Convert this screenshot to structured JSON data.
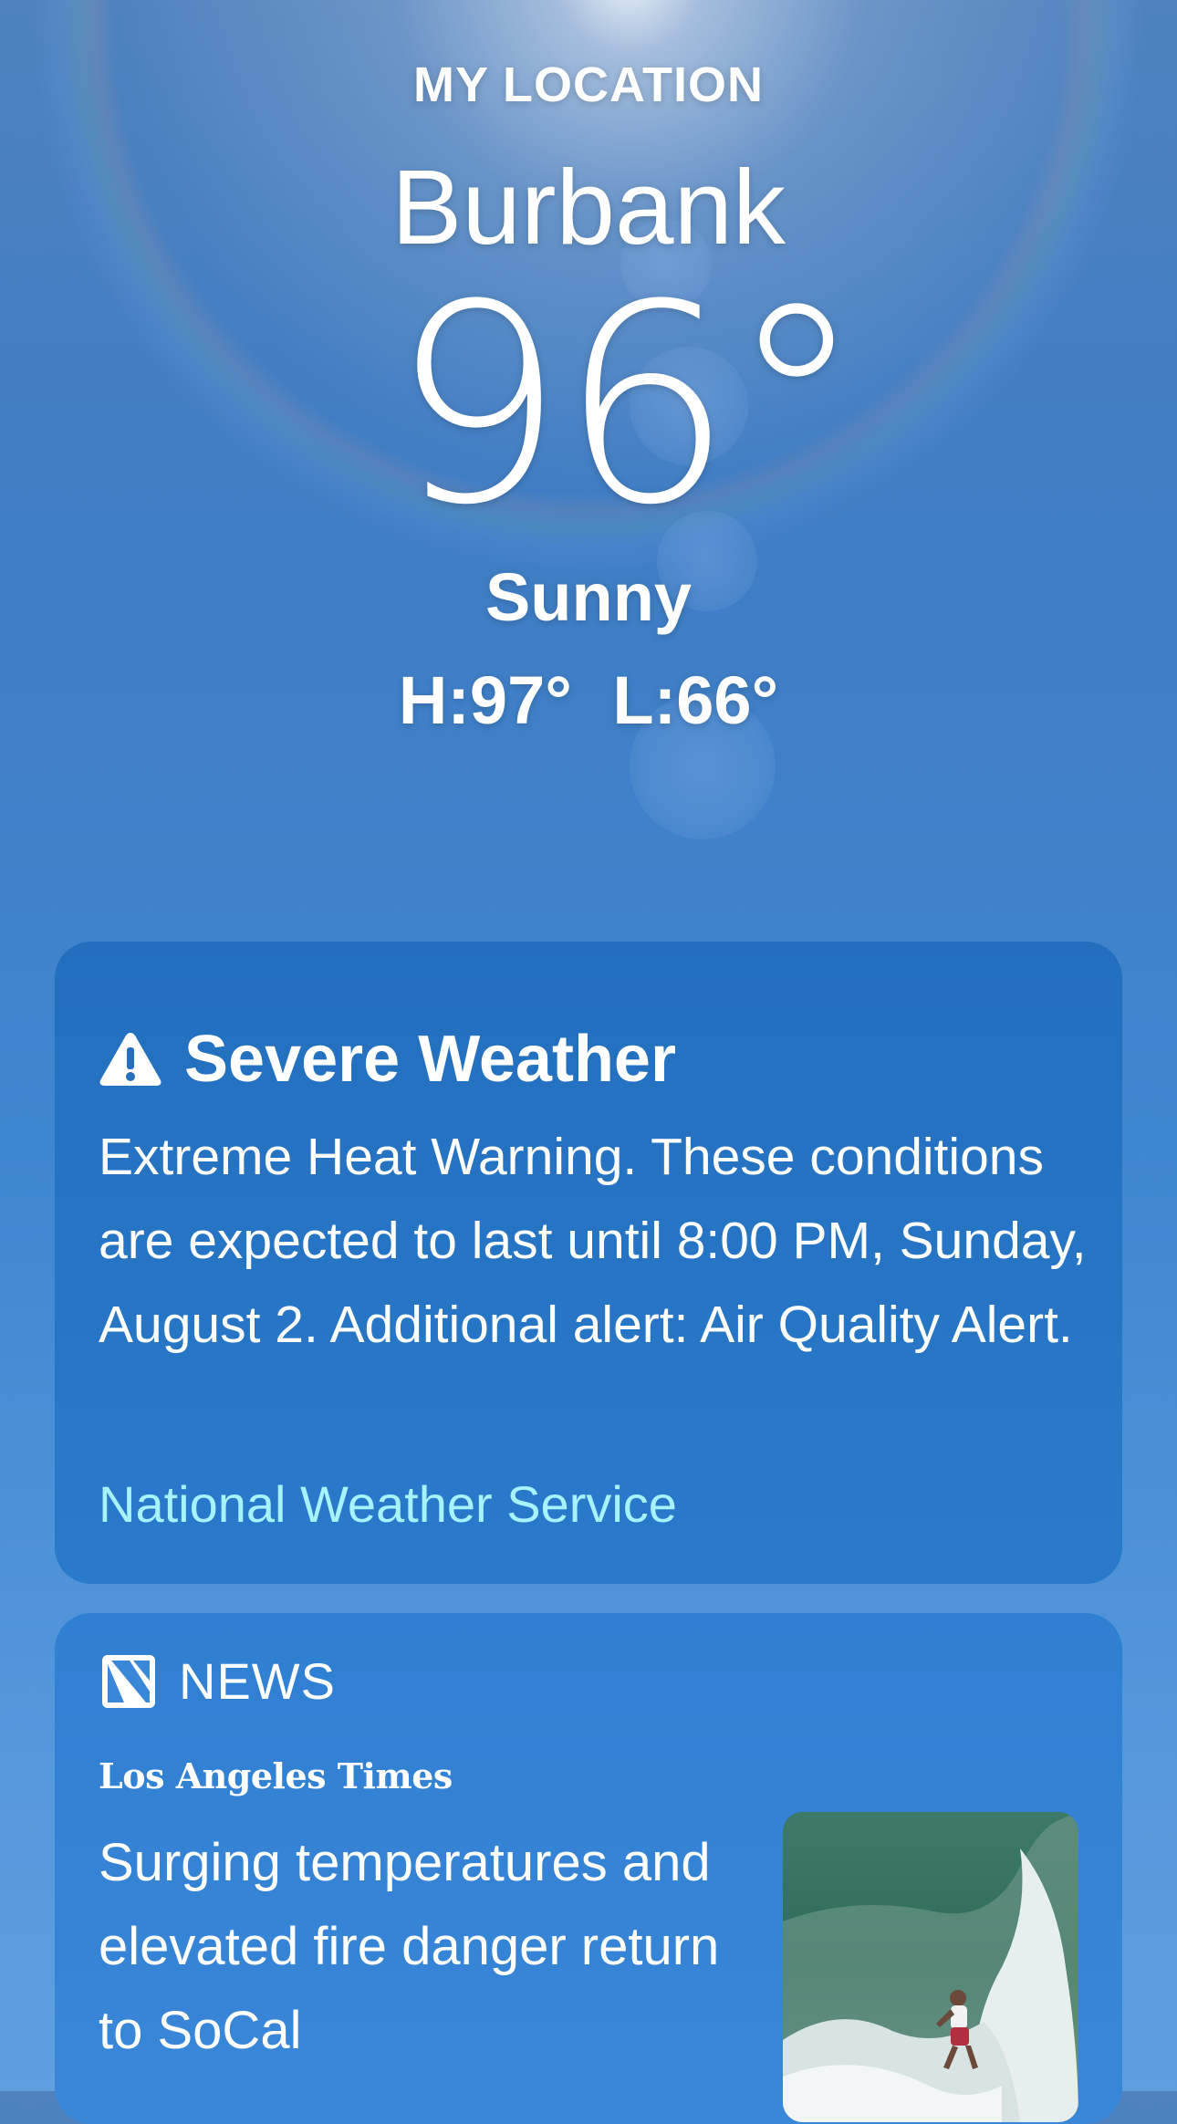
{
  "header": {
    "location_label": "MY LOCATION",
    "city": "Burbank",
    "temperature": "96°",
    "condition": "Sunny",
    "high": "H:97°",
    "low": "L:66°"
  },
  "severe_weather": {
    "title": "Severe Weather",
    "icon": "warning-triangle-icon",
    "text": "Extreme Heat Warning. These conditions are expected to last until 8:00 PM, Sunday, August 2. Additional alert: Air Quality Alert.",
    "source": "National Weather Service",
    "source_color": "#a6f2ff"
  },
  "news": {
    "label": "NEWS",
    "icon": "apple-news-icon",
    "publisher": "Los Angeles Times",
    "headline": "Surging temperatures and elevated fire danger return to SoCal"
  }
}
